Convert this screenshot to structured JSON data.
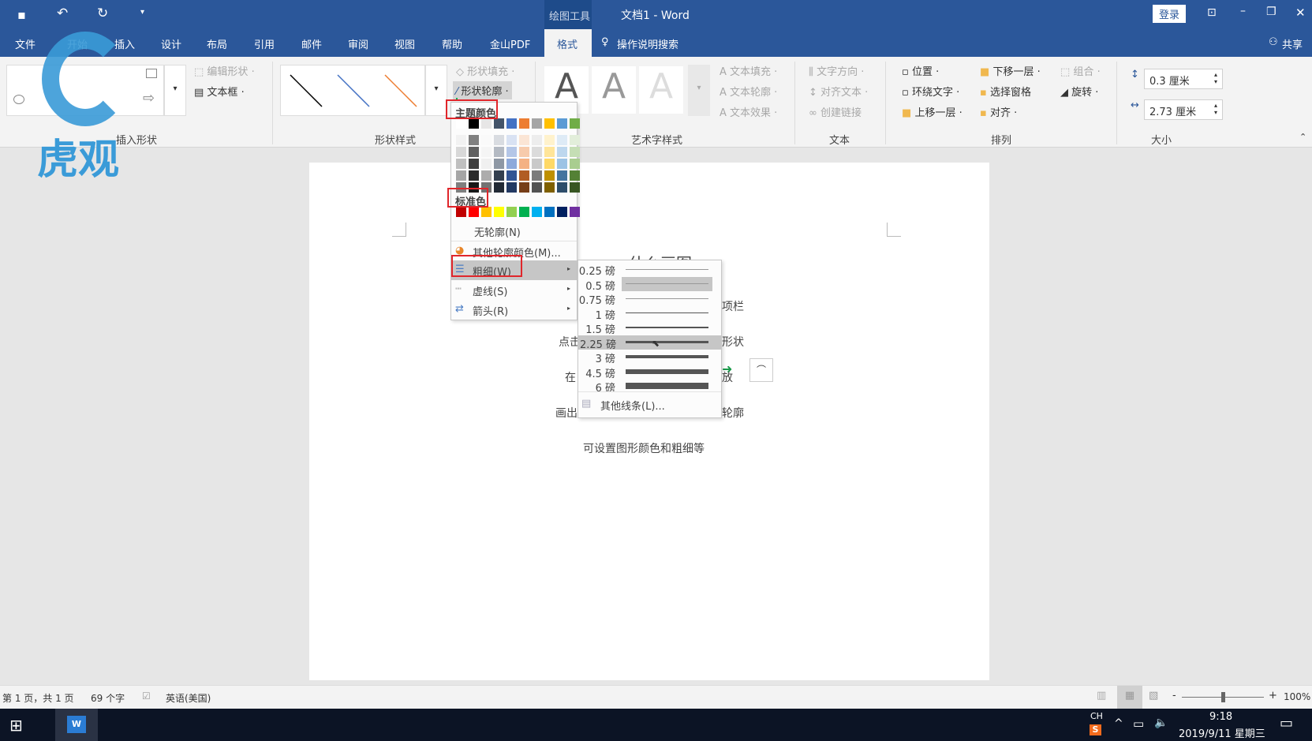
{
  "titlebar": {
    "context_tab": "绘图工具",
    "title": "文档1  -  Word",
    "login": "登录",
    "icons": [
      "save-icon",
      "undo-icon",
      "redo-icon",
      "customize-icon",
      "ribbon-display-icon",
      "minimize-icon",
      "restore-icon",
      "close-icon"
    ]
  },
  "tabs": [
    {
      "label": "文件"
    },
    {
      "label": "开始"
    },
    {
      "label": "插入"
    },
    {
      "label": "设计"
    },
    {
      "label": "布局"
    },
    {
      "label": "引用"
    },
    {
      "label": "邮件"
    },
    {
      "label": "审阅"
    },
    {
      "label": "视图"
    },
    {
      "label": "帮助"
    },
    {
      "label": "金山PDF"
    },
    {
      "label": "格式",
      "active": true
    }
  ],
  "tell_me": "操作说明搜索",
  "share": "共享",
  "ribbon": {
    "groups": {
      "insert_shapes": "插入形状",
      "shape_styles": "形状样式",
      "wordart": "艺术字样式",
      "text": "文本",
      "arrange": "排列",
      "size": "大小"
    },
    "edit_shape": "编辑形状",
    "text_box": "文本框",
    "shape_fill": "形状填充",
    "shape_outline": "形状轮廓",
    "text_fill": "文本填充",
    "text_outline": "文本轮廓",
    "text_effects": "文本效果",
    "text_direction": "文字方向",
    "align_text": "对齐文本",
    "create_link": "创建链接",
    "position": "位置",
    "wrap_text": "环绕文字",
    "bring_forward": "上移一层",
    "send_backward": "下移一层",
    "selection_pane": "选择窗格",
    "align": "对齐",
    "group": "组合",
    "rotate": "旋转",
    "height": "0.3 厘米",
    "width": "2.73 厘米",
    "style_line_colors": [
      "#000000",
      "#4472c4",
      "#ed7d31"
    ]
  },
  "outline_menu": {
    "theme_colors_label": "主题颜色",
    "theme_colors": [
      "#ffffff",
      "#000000",
      "#e7e6e6",
      "#44546a",
      "#4472c4",
      "#ed7d31",
      "#a5a5a5",
      "#ffc000",
      "#5b9bd5",
      "#70ad47"
    ],
    "standard_colors_label": "标准色",
    "standard_colors": [
      "#c00000",
      "#ff0000",
      "#ffc000",
      "#ffff00",
      "#92d050",
      "#00b050",
      "#00b0f0",
      "#0070c0",
      "#002060",
      "#7030a0"
    ],
    "no_outline": "无轮廓(N)",
    "more_colors": "其他轮廓颜色(M)...",
    "weight": "粗细(W)",
    "dashes": "虚线(S)",
    "arrows": "箭头(R)"
  },
  "weight_menu": {
    "items": [
      {
        "label": "0.25 磅",
        "pt": 0.25
      },
      {
        "label": "0.5 磅",
        "pt": 0.5,
        "selected": true
      },
      {
        "label": "0.75 磅",
        "pt": 0.75
      },
      {
        "label": "1 磅",
        "pt": 1
      },
      {
        "label": "1.5 磅",
        "pt": 1.5
      },
      {
        "label": "2.25 磅",
        "pt": 2.25,
        "hover": true
      },
      {
        "label": "3 磅",
        "pt": 3
      },
      {
        "label": "4.5 磅",
        "pt": 4.5
      },
      {
        "label": "6 磅",
        "pt": 6
      }
    ],
    "more_lines": "其他线条(L)..."
  },
  "document": {
    "title_fragment": "…什么画图",
    "lines": [
      {
        "left": "",
        "right": "项栏"
      },
      {
        "left": "点击",
        "right": "形状"
      },
      {
        "left": "在",
        "right": "放"
      },
      {
        "left": "画出",
        "right": "轮廓"
      }
    ],
    "last_line": "可设置图形颜色和粗细等"
  },
  "status": {
    "page": "第 1 页，共 1 页",
    "words": "69 个字",
    "language": "英语(美国)",
    "zoom": "100%",
    "zoom_level_percent": 100
  },
  "taskbar": {
    "ime": "CH",
    "time": "9:18",
    "date": "2019/9/11 星期三"
  },
  "watermark": {
    "text": "虎观"
  }
}
